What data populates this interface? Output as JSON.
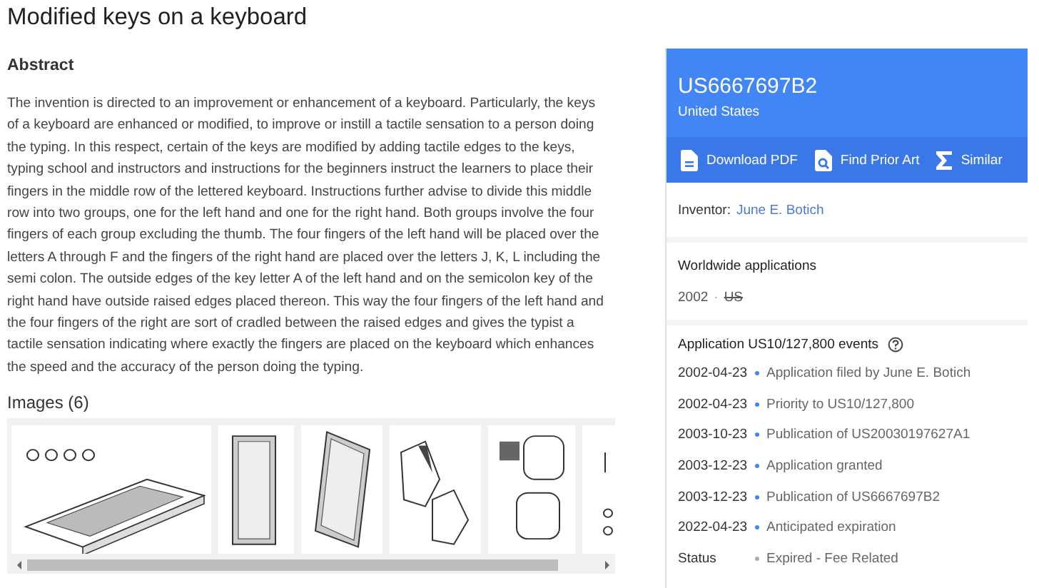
{
  "title": "Modified keys on a keyboard",
  "abstract": {
    "heading": "Abstract",
    "text": "The invention is directed to an improvement or enhancement of a keyboard. Particularly, the keys of a keyboard are enhanced or modified, to improve or instill a tactile sensation to a person doing the typing. In this respect, certain of the keys are modified by adding tactile edges to the keys, typing school and instructors and instructions for the beginners instruct the learners to place their fingers in the middle row of the lettered keyboard. Instructions further advise to divide this middle row into two groups, one for the left hand and one for the right hand. Both groups involve the four fingers of each group excluding the thumb. The four fingers of the left hand will be placed over the letters A through F and the fingers of the right hand are placed over the letters J, K, L including the semi colon. The outside edges of the key letter A of the left hand and on the semicolon key of the right hand have outside raised edges placed thereon. This way the four fingers of the left hand and the four fingers of the right are sort of cradled between the raised edges and gives the typist a tactile sensation indicating where exactly the fingers are placed on the keyboard which enhances the speed and the accuracy of the person doing the typing."
  },
  "images": {
    "heading": "Images (6)"
  },
  "patent": {
    "number": "US6667697B2",
    "country": "United States"
  },
  "actions": [
    {
      "kind": "pdf",
      "label": "Download PDF"
    },
    {
      "kind": "prior",
      "label": "Find Prior Art"
    },
    {
      "kind": "similar",
      "label": "Similar"
    }
  ],
  "inventor": {
    "label": "Inventor:",
    "name": "June E. Botich"
  },
  "worldwide": {
    "heading": "Worldwide applications",
    "year": "2002",
    "separator": "·",
    "country": "US"
  },
  "events": {
    "heading": "Application US10/127,800 events",
    "items": [
      {
        "date": "2002-04-23",
        "text": "Application filed by June E. Botich"
      },
      {
        "date": "2002-04-23",
        "text": "Priority to US10/127,800"
      },
      {
        "date": "2003-10-23",
        "text": "Publication of US20030197627A1"
      },
      {
        "date": "2003-12-23",
        "text": "Application granted"
      },
      {
        "date": "2003-12-23",
        "text": "Publication of US6667697B2"
      },
      {
        "date": "2022-04-23",
        "text": "Anticipated expiration"
      }
    ],
    "status": {
      "label": "Status",
      "text": "Expired - Fee Related"
    }
  }
}
